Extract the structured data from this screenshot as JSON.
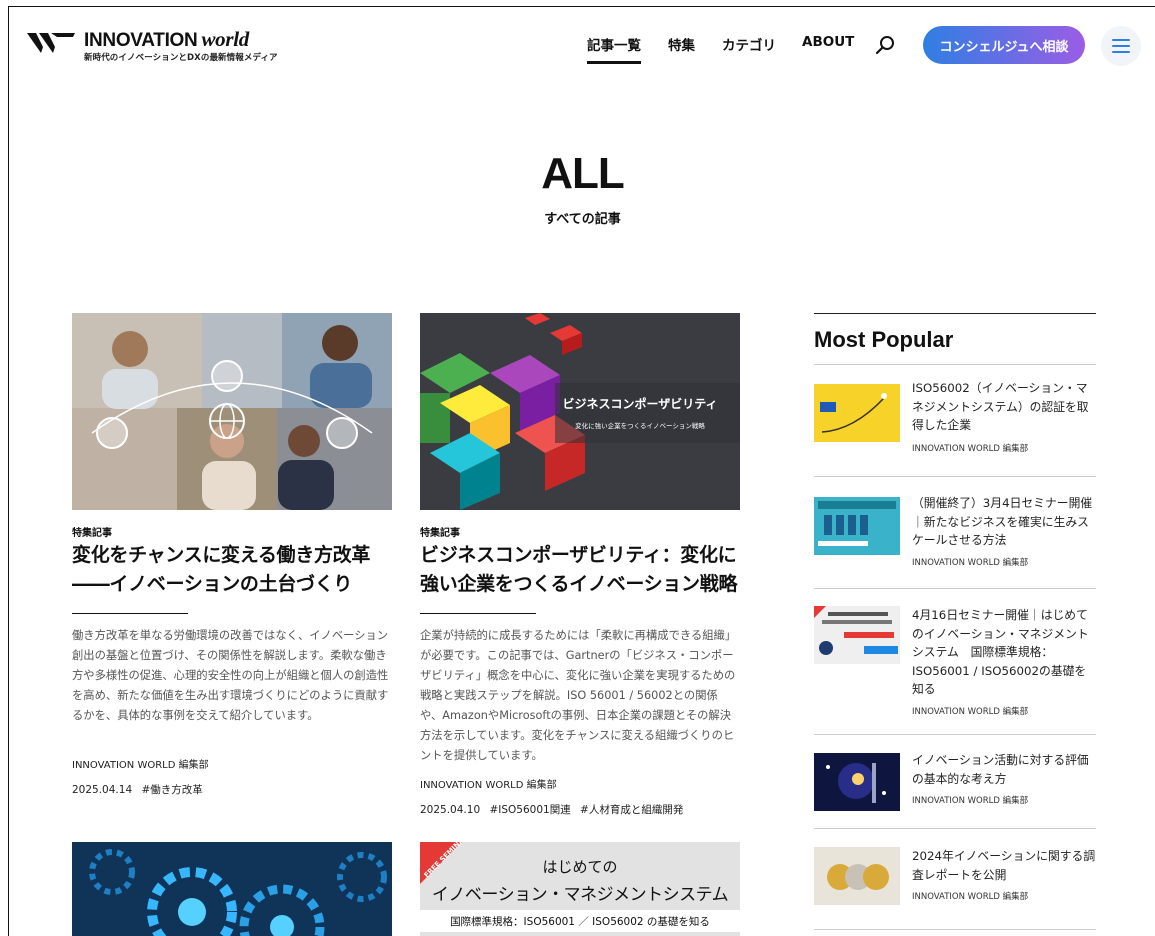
{
  "header": {
    "brand": "INNOVATION",
    "brand_script": "world",
    "tagline": "新時代のイノベーションとDXの最新情報メディア",
    "nav": [
      {
        "label": "記事一覧",
        "active": true
      },
      {
        "label": "特集",
        "active": false
      },
      {
        "label": "カテゴリ",
        "active": false
      },
      {
        "label": "ABOUT",
        "active": false
      }
    ],
    "cta_label": "コンシェルジュへ相談",
    "search_icon": "search-icon",
    "menu_icon": "hamburger-menu-icon"
  },
  "hero": {
    "title": "ALL",
    "subtitle": "すべての記事"
  },
  "articles": [
    {
      "category": "特集記事",
      "title_lines": [
        "変化をチャンスに変える働き方改革",
        "――イノベーションの土台づくり"
      ],
      "excerpt": "働き方改革を単なる労働環境の改善ではなく、イノベーション創出の基盤と位置づけ、その関係性を解説します。柔軟な働き方や多様性の促進、心理的安全性の向上が組織と個人の創造性を高め、新たな価値を生み出す環境づくりにどのように貢献するかを、具体的な事例を交えて紹介しています。",
      "author": "INNOVATION WORLD 編集部",
      "date": "2025.04.14",
      "tags": [
        "#働き方改革"
      ]
    },
    {
      "category": "特集記事",
      "title_lines": [
        "ビジネスコンポーザビリティ：変化に",
        "強い企業をつくるイノベーション戦略"
      ],
      "excerpt": "企業が持続的に成長するためには「柔軟に再構成できる組織」が必要です。この記事では、Gartnerの「ビジネス・コンポーザビリティ」概念を中心に、変化に強い企業を実現するための戦略と実践ステップを解説。ISO 56001 / 56002との関係や、AmazonやMicrosoftの事例、日本企業の課題とその解決方法を示しています。変化をチャンスに変える組織づくりのヒントを提供しています。",
      "author": "INNOVATION WORLD 編集部",
      "date": "2025.04.10",
      "tags": [
        "#ISO56001関連",
        "#人材育成と組織開発"
      ],
      "thumb_title": "ビジネスコンポーザビリティ",
      "thumb_sub": "変化に強い企業をつくるイノベーション戦略"
    },
    {
      "thumb_label": "gears-technology-image"
    },
    {
      "ribbon": "FREE SEMINAR",
      "thumb_line1": "はじめての",
      "thumb_line2": "イノベーション・マネジメントシステム",
      "thumb_line3": "国際標準規格：ISO56001 ／ ISO56002 の基礎を知る"
    }
  ],
  "popular": {
    "heading": "Most Popular",
    "items": [
      {
        "title": "ISO56002（イノベーション・マネジメントシステム）の認証を取得した企業",
        "author": "INNOVATION WORLD 編集部"
      },
      {
        "title": "（開催終了）3月4日セミナー開催｜新たなビジネスを確実に生みスケールさせる方法",
        "author": "INNOVATION WORLD 編集部"
      },
      {
        "title": "4月16日セミナー開催｜はじめてのイノベーション・マネジメントシステム　国際標準規格：ISO56001 / ISO56002の基礎を知る",
        "author": "INNOVATION WORLD 編集部"
      },
      {
        "title": "イノベーション活動に対する評価の基本的な考え方",
        "author": "INNOVATION WORLD 編集部"
      },
      {
        "title": "2024年イノベーションに関する調査レポートを公開",
        "author": "INNOVATION WORLD 編集部"
      }
    ]
  },
  "colors": {
    "cta_start": "#2f7fe3",
    "cta_end": "#9b5de5",
    "text": "#111111",
    "muted": "#555555"
  }
}
